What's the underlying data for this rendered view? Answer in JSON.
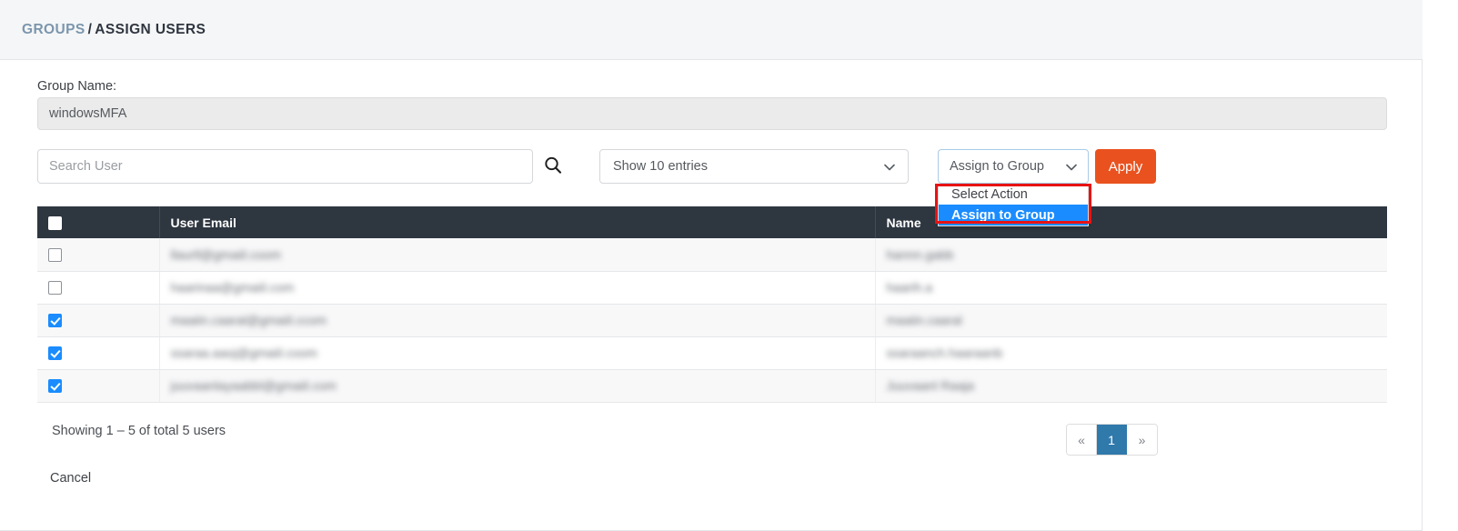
{
  "breadcrumb": {
    "root": "GROUPS",
    "separator": "/",
    "leaf": "ASSIGN USERS"
  },
  "form": {
    "group_name_label": "Group Name:",
    "group_name_value": "windowsMFA"
  },
  "toolbar": {
    "search_placeholder": "Search User",
    "search_value": "",
    "search_icon": "search-icon",
    "entries_select_value": "Show 10 entries",
    "action_select_value": "Assign to Group",
    "action_options": [
      "Select Action",
      "Assign to Group"
    ],
    "action_selected_index": 1,
    "apply_label": "Apply",
    "chevron_icon": "chevron-down-icon"
  },
  "table": {
    "columns": [
      "",
      "User Email",
      "Name"
    ],
    "rows": [
      {
        "checked": false,
        "email": "llaurll@gmaiil.coom",
        "name": "hannn.gabb"
      },
      {
        "checked": false,
        "email": "haarinaa@gmaiil.com",
        "name": "haarih.a"
      },
      {
        "checked": true,
        "email": "maaiin.caaral@gmaiil.ccom",
        "name": "maaiin.caaral"
      },
      {
        "checked": true,
        "email": "ssaraa.aaoj@gmaiil.coom",
        "name": "ssaraanch.haaraanb"
      },
      {
        "checked": true,
        "email": "juuvaanlayaabbl@gmaiil.com",
        "name": "Juuvaanl Raaja"
      }
    ]
  },
  "footer": {
    "showing_text": "Showing 1 – 5 of total 5 users",
    "cancel_label": "Cancel",
    "pagination": {
      "prev_label": "«",
      "next_label": "»",
      "pages": [
        "1"
      ],
      "active_page": "1"
    }
  },
  "colors": {
    "header_dark": "#2e3640",
    "apply_orange": "#e9521f",
    "highlight_blue": "#1a8cff",
    "pager_active_blue": "#3079ab",
    "annotation_red": "#e81313",
    "breadcrumb_link": "#7b96ad"
  }
}
